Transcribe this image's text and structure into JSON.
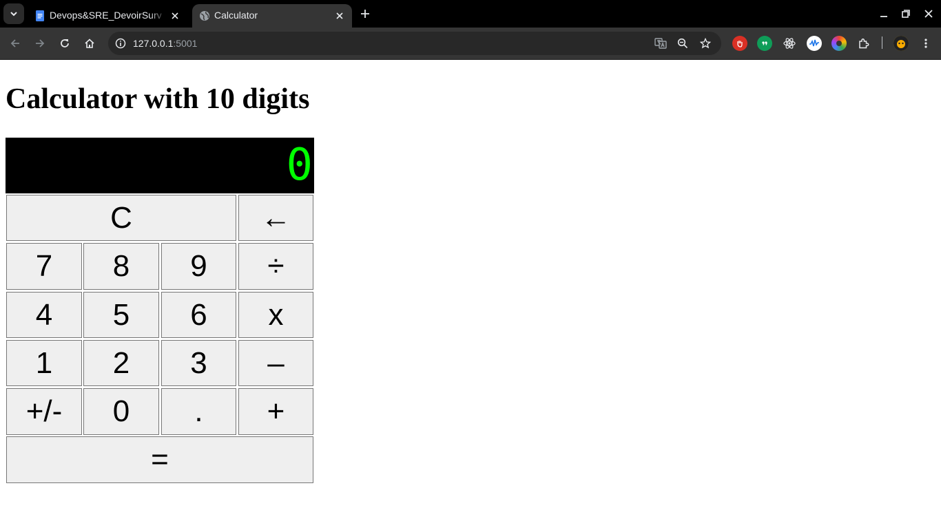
{
  "browser": {
    "tabs": [
      {
        "title": "Devops&SRE_DevoirSurv",
        "active": false,
        "favicon": "google-docs-icon"
      },
      {
        "title": "Calculator",
        "active": true,
        "favicon": "globe-icon"
      }
    ],
    "url_host": "127.0.0.1",
    "url_port": ":5001",
    "extensions": [
      "ad-block-icon",
      "quote-extension-icon",
      "react-devtools-icon",
      "wave-extension-icon",
      "color-wheel-extension-icon",
      "extensions-puzzle-icon",
      "profile-avatar"
    ]
  },
  "page": {
    "title": "Calculator with 10 digits"
  },
  "calculator": {
    "display": "0",
    "display_color": "#00ff00",
    "keys": {
      "clear": "C",
      "backspace": "←",
      "seven": "7",
      "eight": "8",
      "nine": "9",
      "divide": "÷",
      "four": "4",
      "five": "5",
      "six": "6",
      "multiply": "x",
      "one": "1",
      "two": "2",
      "three": "3",
      "subtract": "–",
      "negate": "+/-",
      "zero": "0",
      "decimal": ".",
      "add": "+",
      "equals": "="
    }
  }
}
